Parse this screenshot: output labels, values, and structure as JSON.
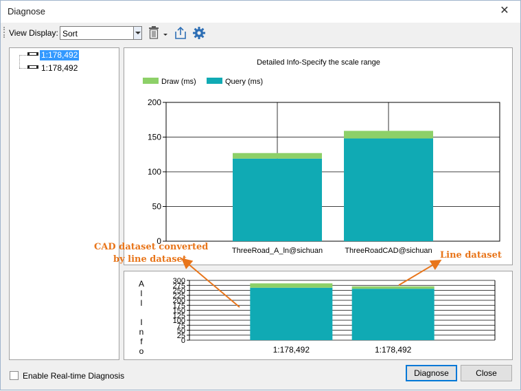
{
  "window": {
    "title": "Diagnose"
  },
  "toolbar": {
    "view_display_label": "View Display:",
    "view_display_value": "Sort",
    "icons": [
      "delete-icon",
      "export-icon",
      "gear-icon"
    ]
  },
  "tree": {
    "items": [
      {
        "label": "1:178,492",
        "selected": true
      },
      {
        "label": "1:178,492",
        "selected": false
      }
    ]
  },
  "colors": {
    "draw": "#8dd068",
    "query": "#10aab4",
    "annotation": "#e8751a",
    "selection": "#3399ff"
  },
  "chart_data": [
    {
      "type": "bar",
      "stacked": true,
      "title": "Detailed Info-Specify the scale range",
      "categories": [
        "ThreeRoad_A_ln@sichuan",
        "ThreeRoadCAD@sichuan"
      ],
      "series": [
        {
          "name": "Query (ms)",
          "values": [
            119,
            148
          ]
        },
        {
          "name": "Draw (ms)",
          "values": [
            8,
            11
          ]
        }
      ],
      "ylim": [
        0,
        200
      ],
      "yticks": [
        0,
        50,
        100,
        150,
        200
      ],
      "grid": true,
      "legend": "top-left"
    },
    {
      "type": "bar",
      "stacked": true,
      "ylabel": "All Info",
      "categories": [
        "1:178,492",
        "1:178,492"
      ],
      "series": [
        {
          "values": [
            263,
            258
          ]
        },
        {
          "values": [
            22,
            12
          ]
        }
      ],
      "ylim": [
        0,
        300
      ],
      "yticks": [
        0,
        25,
        50,
        75,
        100,
        125,
        150,
        175,
        200,
        225,
        250,
        275,
        300
      ],
      "grid": true
    }
  ],
  "annotations": {
    "cad_line1": "CAD dataset converted",
    "cad_line2": "by line dataset",
    "line_dataset": "Line dataset"
  },
  "footer": {
    "realtime_label": "Enable Real-time Diagnosis",
    "realtime_checked": false,
    "diagnose_button": "Diagnose",
    "close_button": "Close"
  }
}
